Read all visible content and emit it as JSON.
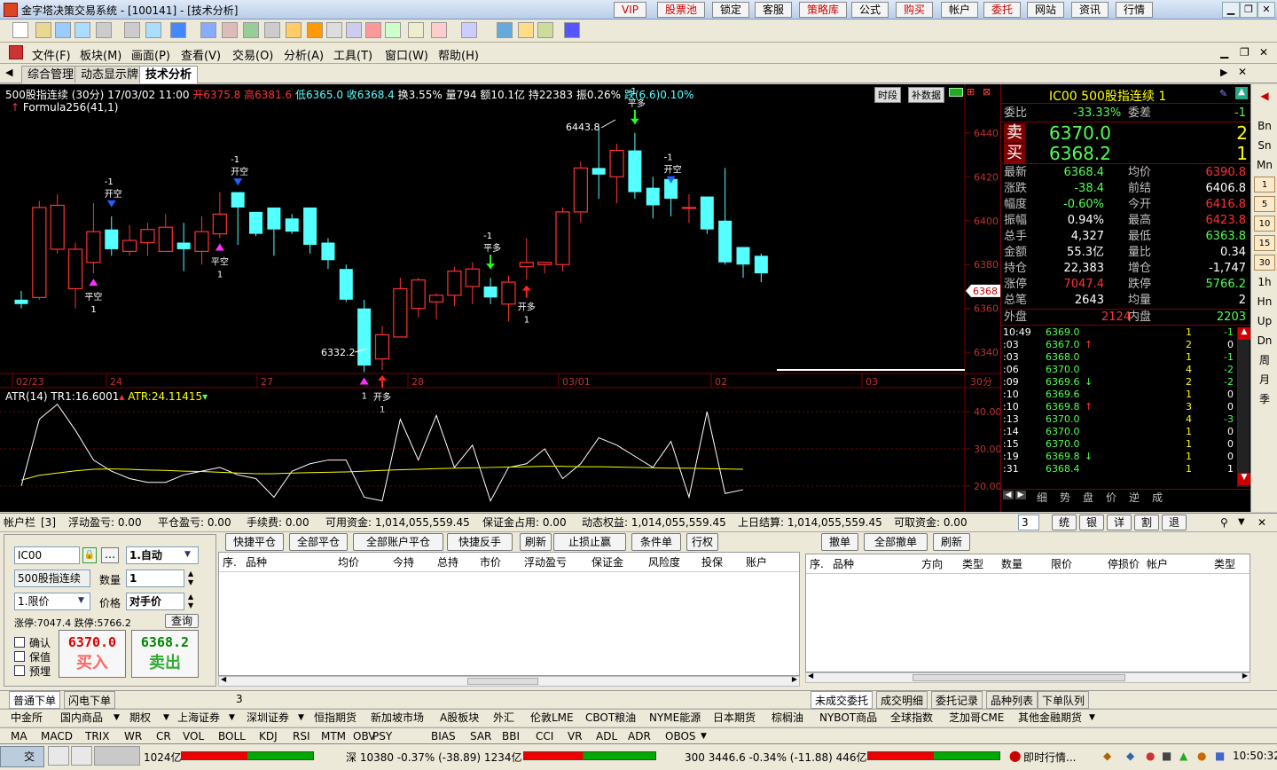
{
  "window": {
    "title": "金字塔决策交易系统 - [100141] - [技术分析]",
    "top_buttons": [
      "VIP",
      "股票池",
      "锁定",
      "客服",
      "策略库",
      "公式",
      "购买",
      "帐户",
      "委托",
      "网站",
      "资讯",
      "行情"
    ]
  },
  "menu": {
    "items": [
      "文件(F)",
      "板块(M)",
      "画面(P)",
      "查看(V)",
      "交易(O)",
      "分析(A)",
      "工具(T)",
      "窗口(W)",
      "帮助(H)"
    ]
  },
  "tabs": [
    "综合管理",
    "动态显示牌",
    "技术分析"
  ],
  "chart_header": {
    "name": "500股指连续 (30分)",
    "date": "17/03/02 11:00",
    "open": "开6375.8",
    "high": "高6381.6",
    "low": "低6365.0",
    "close": "收6368.4",
    "turnover": "换3.55%",
    "volume": "量794",
    "amount": "额10.1亿",
    "hold": "持22383",
    "amp": "振0.26%",
    "change": "跌(6.6)0.10%",
    "formula": "Formula256(41,1)",
    "btn_period": "时段",
    "btn_fill": "补数据"
  },
  "price_axis": {
    "ticks": [
      "6440",
      "6420",
      "6400",
      "6380",
      "6360",
      "6340"
    ],
    "current": "6368"
  },
  "date_axis": {
    "labels": [
      "02/23",
      "24",
      "27",
      "28",
      "03/01",
      "02",
      "03"
    ],
    "right": "30分"
  },
  "price_notes": {
    "high": "6443.8",
    "low": "6332.2"
  },
  "signals": [
    {
      "c": 4,
      "type": "buy",
      "lines": [
        "平空",
        "1"
      ]
    },
    {
      "c": 5,
      "type": "sell",
      "lines": [
        "-1",
        "开空"
      ]
    },
    {
      "c": 11,
      "type": "buy",
      "lines": [
        "平空",
        "1"
      ]
    },
    {
      "c": 12,
      "type": "sell",
      "lines": [
        "-1",
        "开空"
      ]
    },
    {
      "c": 19,
      "type": "buy",
      "lines": [
        "1"
      ]
    },
    {
      "c": 20,
      "type": "buy",
      "lines": [
        "开多",
        "1"
      ]
    },
    {
      "c": 26,
      "type": "sell",
      "lines": [
        "-1",
        "平多"
      ]
    },
    {
      "c": 28,
      "type": "buy",
      "lines": [
        "开多",
        "1"
      ]
    },
    {
      "c": 34,
      "type": "sell",
      "lines": [
        "-1",
        "平多"
      ]
    },
    {
      "c": 36,
      "type": "sell",
      "lines": [
        "-1",
        "开空"
      ]
    }
  ],
  "chart_data": {
    "type": "candlestick",
    "x_label": "30分",
    "ylim": [
      6332,
      6448
    ],
    "series": [
      {
        "name": "500股指连续",
        "values": [
          [
            6364,
            6362,
            6368,
            6360
          ],
          [
            6365,
            6406,
            6409,
            6364
          ],
          [
            6387,
            6407,
            6412,
            6385
          ],
          [
            6369,
            6387,
            6390,
            6360
          ],
          [
            6381,
            6395,
            6408,
            6376
          ],
          [
            6396,
            6387,
            6402,
            6384
          ],
          [
            6386,
            6391,
            6398,
            6384
          ],
          [
            6390,
            6396,
            6399,
            6384
          ],
          [
            6386,
            6397,
            6403,
            6387
          ],
          [
            6390,
            6387,
            6399,
            6377
          ],
          [
            6386,
            6395,
            6402,
            6380
          ],
          [
            6394,
            6403,
            6413,
            6392
          ],
          [
            6413,
            6406,
            6412,
            6389
          ],
          [
            6404,
            6394,
            6398,
            6393
          ],
          [
            6406,
            6396,
            6397,
            6384
          ],
          [
            6401,
            6395,
            6403,
            6394
          ],
          [
            6406,
            6389,
            6406,
            6385
          ],
          [
            6390,
            6382,
            6392,
            6378
          ],
          [
            6378,
            6364,
            6380,
            6363
          ],
          [
            6360,
            6334,
            6364,
            6331
          ],
          [
            6337,
            6348,
            6352,
            6332
          ],
          [
            6347,
            6369,
            6374,
            6348
          ],
          [
            6360,
            6373,
            6374,
            6356
          ],
          [
            6363,
            6366,
            6367,
            6355
          ],
          [
            6366,
            6377,
            6379,
            6361
          ],
          [
            6370,
            6378,
            6381,
            6362
          ],
          [
            6370,
            6365,
            6374,
            6362
          ],
          [
            6362,
            6372,
            6375,
            6354
          ],
          [
            6379,
            6381,
            6392,
            6373
          ],
          [
            6380,
            6381,
            6381,
            6376
          ],
          [
            6380,
            6404,
            6406,
            6377
          ],
          [
            6404,
            6424,
            6427,
            6399
          ],
          [
            6424,
            6421,
            6443,
            6410
          ],
          [
            6420,
            6432,
            6435,
            6408
          ],
          [
            6432,
            6413,
            6440,
            6410
          ],
          [
            6415,
            6407,
            6420,
            6401
          ],
          [
            6419,
            6410,
            6413,
            6402
          ],
          [
            6406,
            6406,
            6412,
            6399
          ],
          [
            6411,
            6396,
            6411,
            6394
          ],
          [
            6400,
            6381,
            6424,
            6380
          ],
          [
            6388,
            6380,
            6386,
            6374
          ],
          [
            6384,
            6376,
            6385,
            6372
          ]
        ]
      }
    ]
  },
  "atr": {
    "label": "ATR(14)",
    "tr": "TR1:16.6001",
    "atr": "ATR:24.11415",
    "ticks": [
      "40.00",
      "30.00",
      "20.00"
    ],
    "ylim": [
      14,
      46
    ],
    "tr_values": [
      20,
      38,
      42,
      35,
      27,
      24,
      22,
      21,
      21,
      23,
      24,
      25,
      23,
      22,
      17,
      24,
      26,
      27,
      27,
      17,
      16,
      38,
      27,
      39,
      25,
      31,
      16,
      25,
      26,
      30,
      22,
      26,
      33,
      31,
      28,
      25,
      32,
      17,
      40,
      18,
      19
    ],
    "atr_values": [
      21.6,
      22.9,
      23.5,
      24.1,
      24.5,
      24.6,
      24.5,
      24.3,
      24.2,
      24.0,
      23.9,
      23.7,
      23.5,
      23.3,
      23.3,
      23.5,
      23.6,
      23.7,
      23.8,
      24.0,
      24.2,
      24.4,
      24.5,
      24.7,
      24.8,
      24.9,
      25.0,
      25.1,
      25.2,
      25.3,
      25.3,
      25.2,
      25.2,
      25.1,
      25.0,
      24.9,
      24.8,
      24.8,
      24.7,
      24.6,
      24.5
    ]
  },
  "quote": {
    "title": "IC00  500股指连续  1",
    "weibi": "委比",
    "weibi_v": "-33.33%",
    "weicha": "委差",
    "weicha_v": "-1",
    "sell_label": "卖",
    "sell_price": "6370.0",
    "sell_qty": "2",
    "buy_label": "买",
    "buy_price": "6368.2",
    "buy_qty": "1",
    "rows": [
      [
        "最新",
        "6368.4",
        "均价",
        "6390.8"
      ],
      [
        "涨跌",
        "-38.4",
        "前结",
        "6406.8"
      ],
      [
        "幅度",
        "-0.60%",
        "今开",
        "6416.8"
      ],
      [
        "振幅",
        "0.94%",
        "最高",
        "6423.8"
      ],
      [
        "总手",
        "4,327",
        "最低",
        "6363.8"
      ],
      [
        "金额",
        "55.3亿",
        "量比",
        "0.34"
      ],
      [
        "持仓",
        "22,383",
        "增仓",
        "-1,747"
      ],
      [
        "涨停",
        "7047.4",
        "跌停",
        "5766.2"
      ],
      [
        "总笔",
        "2643",
        "均量",
        "2"
      ]
    ],
    "waipan": "外盘",
    "waipan_v": "2124",
    "neipan": "内盘",
    "neipan_v": "2203",
    "ticks": [
      [
        "10:49",
        "6369.0",
        "",
        "1",
        "-1"
      ],
      [
        ":03",
        "6367.0",
        "↑",
        "2",
        "0"
      ],
      [
        ":03",
        "6368.0",
        "",
        "1",
        "-1"
      ],
      [
        ":06",
        "6370.0",
        "",
        "4",
        "-2"
      ],
      [
        ":09",
        "6369.6",
        "↓",
        "2",
        "-2"
      ],
      [
        ":10",
        "6369.6",
        "",
        "1",
        "0"
      ],
      [
        ":10",
        "6369.8",
        "↑",
        "3",
        "0"
      ],
      [
        ":13",
        "6370.0",
        "",
        "4",
        "-3"
      ],
      [
        ":14",
        "6370.0",
        "",
        "1",
        "0"
      ],
      [
        ":15",
        "6370.0",
        "",
        "1",
        "0"
      ],
      [
        ":19",
        "6369.8",
        "↓",
        "1",
        "0"
      ],
      [
        ":31",
        "6368.4",
        "",
        "1",
        "1"
      ]
    ],
    "bottom_tabs": [
      "细",
      "势",
      "盘",
      "价",
      "逆",
      "成"
    ]
  },
  "sidebar": [
    "Bn",
    "Sn",
    "Mn",
    "1",
    "5",
    "10",
    "15",
    "30",
    "1h",
    "Hn",
    "Up",
    "Dn",
    "周",
    "月",
    "季"
  ],
  "account": {
    "label": "帐户栏",
    "count": "[3]",
    "float_pl": "浮动盈亏:  0.00",
    "close_pl": "平仓盈亏:  0.00",
    "fee": "手续费:  0.00",
    "avail": "可用资金:  1,014,055,559.45",
    "margin": "保证金占用:  0.00",
    "dyn": "动态权益:  1,014,055,559.45",
    "settle": "上日结算:  1,014,055,559.45",
    "withdraw": "可取资金:  0.00",
    "count_sel": "3",
    "buttons": [
      "统",
      "银",
      "详",
      "割",
      "退"
    ]
  },
  "order": {
    "code": "IC00",
    "mode": "1.自动",
    "name": "500股指连续",
    "qty_label": "数量",
    "qty": "1",
    "type": "1.限价",
    "price_label": "价格",
    "price": "对手价",
    "limits": "涨停:7047.4 跌停:5766.2",
    "query": "查询",
    "checks": [
      "确认",
      "保值",
      "预埋"
    ],
    "sell_price": "6370.0",
    "buy_text": "买入",
    "buy_price": "6368.2",
    "sell_text": "卖出"
  },
  "pos_buttons": [
    "快捷平仓",
    "全部平仓",
    "全部账户平仓",
    "快捷反手",
    "刷新",
    "止损止赢",
    "条件单",
    "行权"
  ],
  "pos_headers": [
    "序.",
    "品种",
    "均价",
    "今持",
    "总持",
    "市价",
    "浮动盈亏",
    "保证金",
    "风险度",
    "投保",
    "账户"
  ],
  "ord_buttons": [
    "撤单",
    "全部撤单",
    "刷新"
  ],
  "ord_headers": [
    "序.",
    "品种",
    "方向",
    "类型",
    "数量",
    "限价",
    "停损价",
    "帐户",
    "类型"
  ],
  "bottom_left_tabs": [
    "普通下单",
    "闪电下单"
  ],
  "bottom_left_num": "3",
  "bottom_right_tabs": [
    "未成交委托",
    "成交明细",
    "委托记录",
    "品种列表",
    "下单队列"
  ],
  "market_tabs": [
    "中金所",
    "国内商品",
    "期权",
    "上海证券",
    "深圳证券",
    "恒指期货",
    "新加坡市场",
    "A股板块",
    "外汇",
    "伦敦LME",
    "CBOT粮油",
    "NYME能源",
    "日本期货",
    "棕榈油",
    "NYBOT商品",
    "全球指数",
    "芝加哥CME",
    "其他金融期货"
  ],
  "indicator_tabs": [
    "MA",
    "MACD",
    "TRIX",
    "WR",
    "CR",
    "VOL",
    "BOLL",
    "KDJ",
    "RSI",
    "MTM",
    "OBV",
    "PSY",
    "BIAS",
    "SAR",
    "BBI",
    "CCI",
    "VR",
    "ADL",
    "ADR",
    "OBOS"
  ],
  "status": {
    "s1": "1024亿",
    "s2": "深 10380  -0.37%  (-38.89)  1234亿",
    "s3": "300  3446.6  -0.34%  (-11.88)  446亿",
    "s4": "即时行情...",
    "time": "10:50:32",
    "start": "交"
  },
  "colors": {
    "up": "#ff3232",
    "down": "#54ffff",
    "bg": "#000000",
    "grid": "#800000",
    "yellow": "#ffff00"
  }
}
